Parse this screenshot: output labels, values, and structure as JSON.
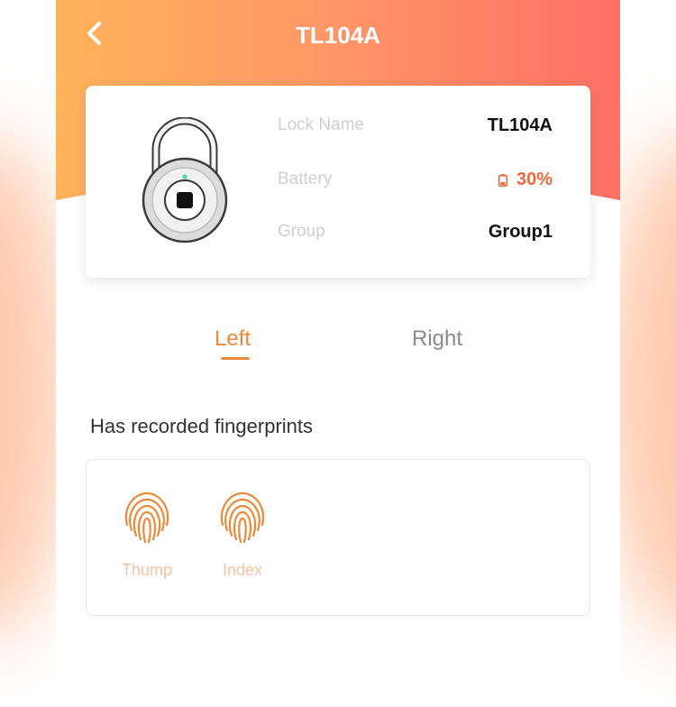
{
  "header": {
    "title": "TL104A",
    "back_icon": "chevron-left-icon"
  },
  "lock_info": {
    "lock_icon": "padlock-icon",
    "rows": [
      {
        "label": "Lock Name",
        "value": "TL104A"
      },
      {
        "label": "Battery",
        "value": "30%",
        "icon": "battery-icon"
      },
      {
        "label": "Group",
        "value": "Group1"
      }
    ]
  },
  "tabs": [
    {
      "label": "Left",
      "active": true
    },
    {
      "label": "Right",
      "active": false
    }
  ],
  "fingerprints": {
    "section_title": "Has recorded fingerprints",
    "items": [
      {
        "label": "Thump",
        "icon": "fingerprint-icon"
      },
      {
        "label": "Index",
        "icon": "fingerprint-icon"
      }
    ]
  },
  "colors": {
    "accent": "#ee8a37",
    "battery_low": "#f0673f",
    "header_gradient_start": "#ffb25a",
    "header_gradient_end": "#ff6f66"
  }
}
